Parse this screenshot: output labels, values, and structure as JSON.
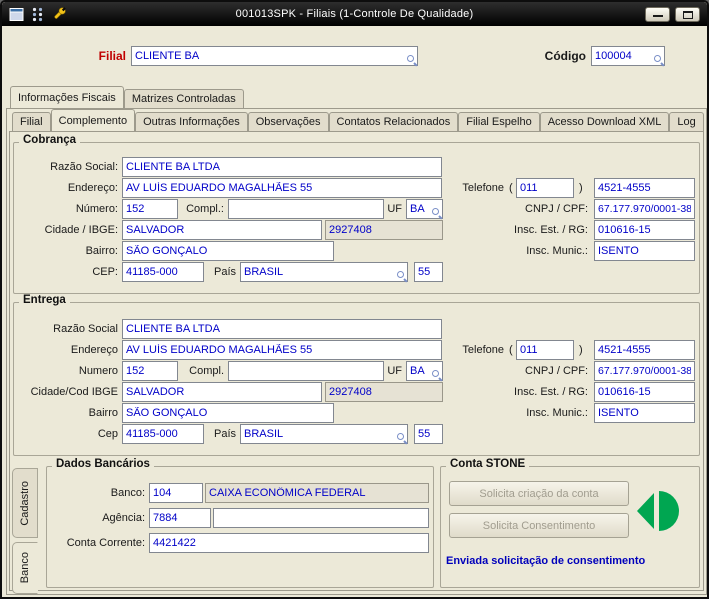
{
  "colors": {
    "input_text": "#0000C8",
    "filial_label_red": "#C00000",
    "status_text_blue": "#0000BB",
    "stone_icon_green": "#00A651",
    "titlebar": "#000000",
    "window_bg": "#ECE9D8"
  },
  "window": {
    "title": "001013SPK - Filiais (1-Controle De Qualidade)"
  },
  "header": {
    "filial_label": "Filial",
    "filial_value": "CLIENTE BA",
    "codigo_label": "Código",
    "codigo_value": "100004"
  },
  "tabs_outer": {
    "fiscais": "Informações Fiscais",
    "matrizes": "Matrizes Controladas"
  },
  "tabs_inner": {
    "filial": "Filial",
    "complemento": "Complemento",
    "outras": "Outras Informações",
    "observacoes": "Observações",
    "contatos": "Contatos Relacionados",
    "espelho": "Filial Espelho",
    "xml": "Acesso Download XML",
    "log": "Log"
  },
  "cobranca": {
    "title": "Cobrança",
    "razao_social": {
      "label": "Razão Social:",
      "value": "CLIENTE BA LTDA"
    },
    "endereco": {
      "label": "Endereço:",
      "value": "AV LUÍS EDUARDO MAGALHÃES 55"
    },
    "telefone": {
      "label": "Telefone",
      "paren_open": "(",
      "ddd": "011",
      "paren_close": ")",
      "numero": "4521-4555"
    },
    "numero": {
      "label": "Número:",
      "value": "152"
    },
    "compl": {
      "label": "Compl.:",
      "value": ""
    },
    "uf": {
      "label": "UF",
      "value": "BA"
    },
    "cnpj": {
      "label": "CNPJ / CPF:",
      "value": "67.177.970/0001-38"
    },
    "cidade": {
      "label": "Cidade / IBGE:",
      "value": "SALVADOR",
      "ibge": "2927408"
    },
    "insc_est": {
      "label": "Insc. Est. / RG:",
      "value": "010616-15"
    },
    "bairro": {
      "label": "Bairro:",
      "value": "SÃO GONÇALO"
    },
    "insc_mun": {
      "label": "Insc. Munic.:",
      "value": "ISENTO"
    },
    "cep": {
      "label": "CEP:",
      "value": "41185-000"
    },
    "pais": {
      "label": "País",
      "value": "BRASIL",
      "codigo": "55"
    }
  },
  "entrega": {
    "title": "Entrega",
    "razao_social": {
      "label": "Razão Social",
      "value": "CLIENTE BA LTDA"
    },
    "endereco": {
      "label": "Endereço",
      "value": "AV LUÍS EDUARDO MAGALHÃES 55"
    },
    "telefone": {
      "label": "Telefone",
      "paren_open": "(",
      "ddd": "011",
      "paren_close": ")",
      "numero": "4521-4555"
    },
    "numero": {
      "label": "Numero",
      "value": "152"
    },
    "compl": {
      "label": "Compl.",
      "value": ""
    },
    "uf": {
      "label": "UF",
      "value": "BA"
    },
    "cnpj": {
      "label": "CNPJ / CPF:",
      "value": "67.177.970/0001-38"
    },
    "cidade": {
      "label": "Cidade/Cod IBGE",
      "value": "SALVADOR",
      "ibge": "2927408"
    },
    "insc_est": {
      "label": "Insc. Est. / RG:",
      "value": "010616-15"
    },
    "bairro": {
      "label": "Bairro",
      "value": "SÃO GONÇALO"
    },
    "insc_mun": {
      "label": "Insc. Munic.:",
      "value": "ISENTO"
    },
    "cep": {
      "label": "Cep",
      "value": "41185-000"
    },
    "pais": {
      "label": "País",
      "value": "BRASIL",
      "codigo": "55"
    }
  },
  "side_tabs": {
    "cadastro": "Cadastro",
    "banco": "Banco"
  },
  "dados_bancarios": {
    "title": "Dados Bancários",
    "banco_label": "Banco:",
    "banco_codigo": "104",
    "banco_nome": "CAIXA ECONÔMICA FEDERAL",
    "agencia_label": "Agência:",
    "agencia_valor": "7884",
    "agencia_extra": "",
    "conta_label": "Conta Corrente:",
    "conta_valor": "4421422"
  },
  "conta_stone": {
    "title": "Conta STONE",
    "botao_criacao": "Solicita criação da conta",
    "botao_consentimento": "Solicita Consentimento",
    "status": "Enviada solicitação de consentimento"
  }
}
